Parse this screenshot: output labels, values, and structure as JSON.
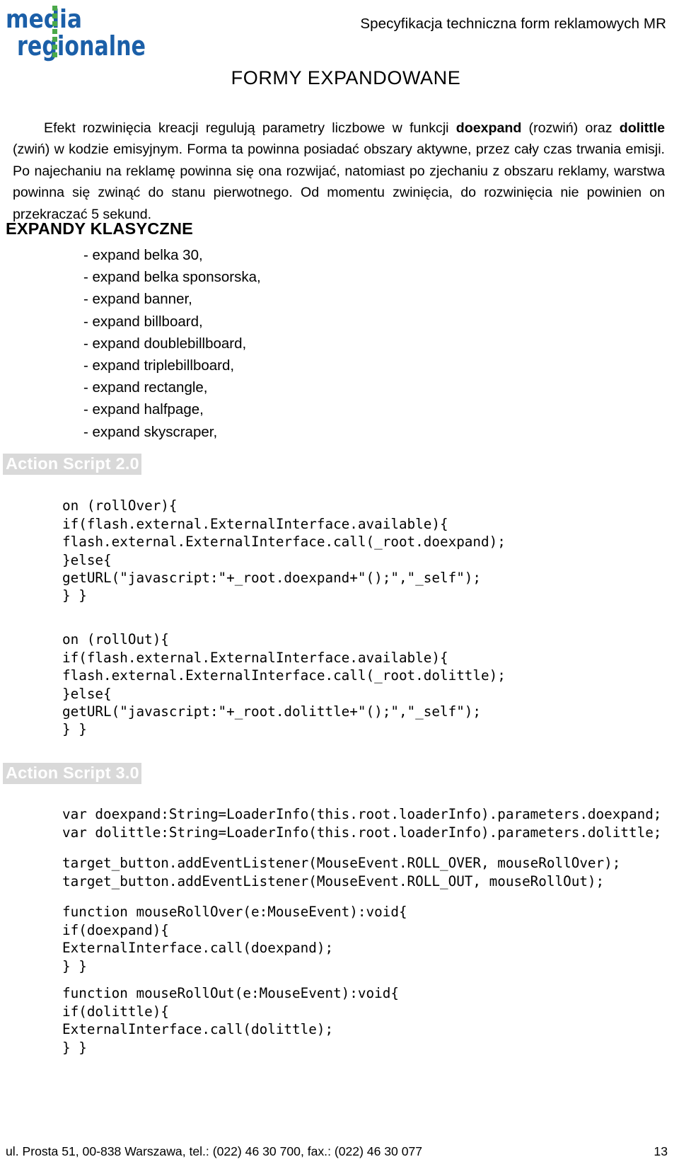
{
  "header": {
    "logo": {
      "line1": "media",
      "line2": "regionalne",
      "color_blue": "#1b5fa8",
      "color_green": "#4aa94a"
    },
    "title": "Specyfikacja techniczna form reklamowych MR"
  },
  "page_title": "FORMY EXPANDOWANE",
  "intro": {
    "part1": "Efekt rozwinięcia kreacji regulują parametry liczbowe w funkcji ",
    "bold1": "doexpand",
    "part2": " (rozwiń) oraz ",
    "bold2": "dolittle",
    "part3": " (zwiń) w kodzie emisyjnym. Forma ta powinna posiadać obszary aktywne, przez cały czas trwania emisji. Po najechaniu na reklamę powinna się ona rozwijać, natomiast po zjechaniu z obszaru reklamy, warstwa powinna się zwinąć do stanu pierwotnego. Od momentu zwinięcia, do rozwinięcia nie powinien on przekraczać 5 sekund."
  },
  "sections": {
    "klasyczne": {
      "heading": "EXPANDY KLASYCZNE",
      "items": [
        "- expand belka 30,",
        "- expand belka sponsorska,",
        "- expand banner,",
        "- expand billboard,",
        "- expand doublebillboard,",
        "- expand triplebillboard,",
        "- expand rectangle,",
        "- expand halfpage,",
        "- expand skyscraper,"
      ]
    },
    "action_script_2": {
      "title": "Action Script 2.0",
      "code_rollover": "on (rollOver){\nif(flash.external.ExternalInterface.available){\nflash.external.ExternalInterface.call(_root.doexpand);\n}else{\ngetURL(\"javascript:\"+_root.doexpand+\"();\",\"_self\");\n} }",
      "code_rollout": "on (rollOut){\nif(flash.external.ExternalInterface.available){\nflash.external.ExternalInterface.call(_root.dolittle);\n}else{\ngetURL(\"javascript:\"+_root.dolittle+\"();\",\"_self\");\n} }"
    },
    "action_script_3": {
      "title": "Action Script 3.0",
      "code_vars": "var doexpand:String=LoaderInfo(this.root.loaderInfo).parameters.doexpand;\nvar dolittle:String=LoaderInfo(this.root.loaderInfo).parameters.dolittle;",
      "code_listeners": "target_button.addEventListener(MouseEvent.ROLL_OVER, mouseRollOver);\ntarget_button.addEventListener(MouseEvent.ROLL_OUT, mouseRollOut);",
      "code_rollover": "function mouseRollOver(e:MouseEvent):void{\nif(doexpand){\nExternalInterface.call(doexpand);\n} }",
      "code_rollout": "function mouseRollOut(e:MouseEvent):void{\nif(dolittle){\nExternalInterface.call(dolittle);\n} }"
    }
  },
  "footer": {
    "address": "ul. Prosta 51, 00-838  Warszawa, tel.: (022) 46 30 700, fax.: (022) 46 30 077",
    "page_number": "13"
  }
}
